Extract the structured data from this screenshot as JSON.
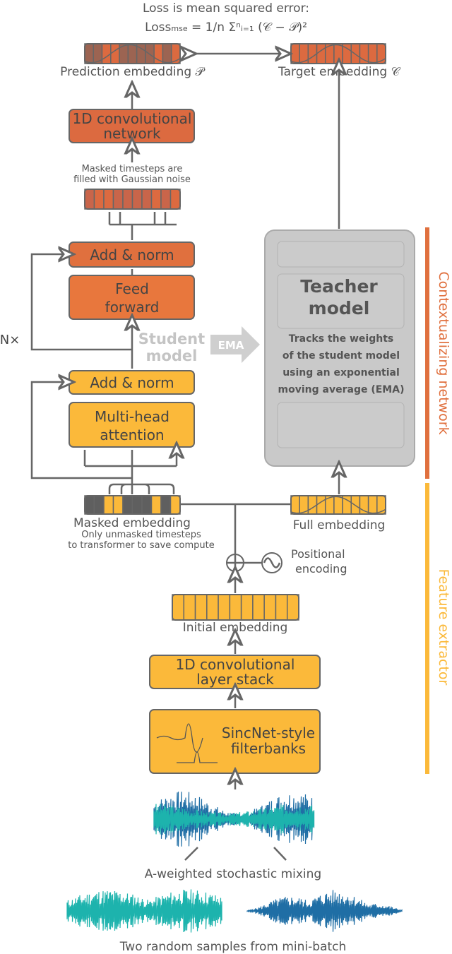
{
  "loss": {
    "title": "Loss is mean squared error:",
    "formula": "Loss",
    "formula_sub": "mse",
    "formula_rest": " = 1/n Σⁿᵢ₌₁ (𝒞 − 𝒫)²"
  },
  "prediction_label": "Prediction embedding 𝒫",
  "target_label": "Target embedding 𝒞",
  "conv_net": [
    "1D convolutional",
    "network"
  ],
  "masked_note": [
    "Masked timesteps are",
    "filled with Gaussian noise"
  ],
  "add_norm": "Add & norm",
  "feed_forward": [
    "Feed",
    "forward"
  ],
  "student": [
    "Student",
    "model"
  ],
  "ema": "EMA",
  "nx": "N×",
  "mha": [
    "Multi-head",
    "attention"
  ],
  "teacher": {
    "title": [
      "Teacher",
      "model"
    ],
    "desc": [
      "Tracks the weights",
      "of the student model",
      "using an exponential",
      "moving average (EMA)"
    ]
  },
  "masked_label": "Masked embedding",
  "masked_sub": [
    "Only unmasked timesteps",
    "to transformer to save compute"
  ],
  "full_label": "Full embedding",
  "pos_enc": [
    "Positional",
    "encoding"
  ],
  "initial_label": "Initial embedding",
  "conv_stack": [
    "1D convolutional",
    "layer stack"
  ],
  "sincnet": [
    "SincNet-style",
    "filterbanks"
  ],
  "mixing": "A-weighted stochastic mixing",
  "samples": "Two random samples from mini-batch",
  "side": {
    "context": "Contextualizing network",
    "feature": "Feature extractor"
  },
  "colors": {
    "orange_dark": "#dc6a40",
    "orange": "#e8773d",
    "yellow": "#fbb93a",
    "gray": "#5f5f5f",
    "teacher": "#c9c9c9",
    "teal": "#1db3ad",
    "blue": "#1f6ea5"
  }
}
